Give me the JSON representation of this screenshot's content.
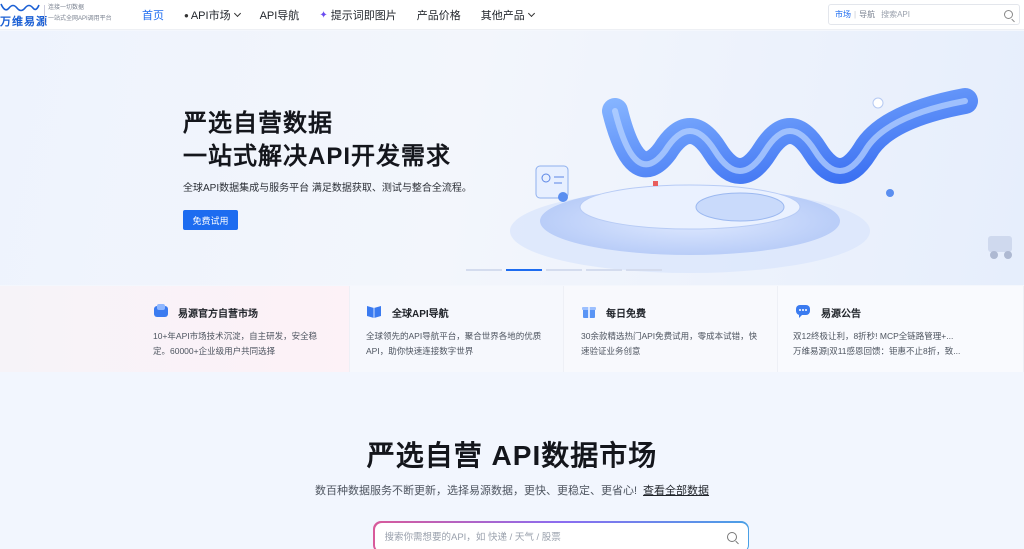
{
  "nav": {
    "logo_name": "万维易源",
    "logo_tagline_1": "连接一切数据",
    "logo_tagline_2": "一站式全网API调用平台",
    "items": [
      {
        "label": "首页",
        "active": true
      },
      {
        "label": "API市场",
        "dropdown": true
      },
      {
        "label": "API导航"
      },
      {
        "label": "提示词即图片"
      },
      {
        "label": "产品价格"
      },
      {
        "label": "其他产品",
        "dropdown": true
      }
    ],
    "search": {
      "category_active": "市场",
      "category_other": "导航",
      "placeholder": "搜索API"
    }
  },
  "hero": {
    "title_line1": "严选自营数据",
    "title_line2": "一站式解决API开发需求",
    "subtitle": "全球API数据集成与服务平台 满足数据获取、测试与整合全流程。",
    "cta_label": "免费试用",
    "carousel_count": 5,
    "carousel_active": 1
  },
  "features": [
    {
      "title": "易源官方自营市场",
      "desc": [
        "10+年API市场技术沉淀，自主研发，安全稳",
        "定。60000+企业级用户共同选择"
      ],
      "icon": "cube-icon"
    },
    {
      "title": "全球API导航",
      "desc": [
        "全球领先的API导航平台，聚合世界各地的优质",
        "API，助你快速连接数字世界"
      ],
      "icon": "book-icon"
    },
    {
      "title": "每日免费",
      "desc": [
        "30余款精选热门API免费试用，零成本试错，快",
        "速验证业务创意"
      ],
      "icon": "gift-icon"
    },
    {
      "title": "易源公告",
      "desc": [
        "双12终极让利，8折秒! MCP全链路管理+...",
        "万维易源|双11感恩回馈：钜惠不止8折，致..."
      ],
      "icon": "chat-icon"
    }
  ],
  "market": {
    "title": "严选自营 API数据市场",
    "subtitle": "数百种数据服务不断更新，选择易源数据，更快、更稳定、更省心!",
    "link": "查看全部数据",
    "search_placeholder": "搜索你需想要的API，如 快递 / 天气 / 股票"
  },
  "colors": {
    "accent": "#1d6cf0",
    "text": "#1f2329"
  }
}
